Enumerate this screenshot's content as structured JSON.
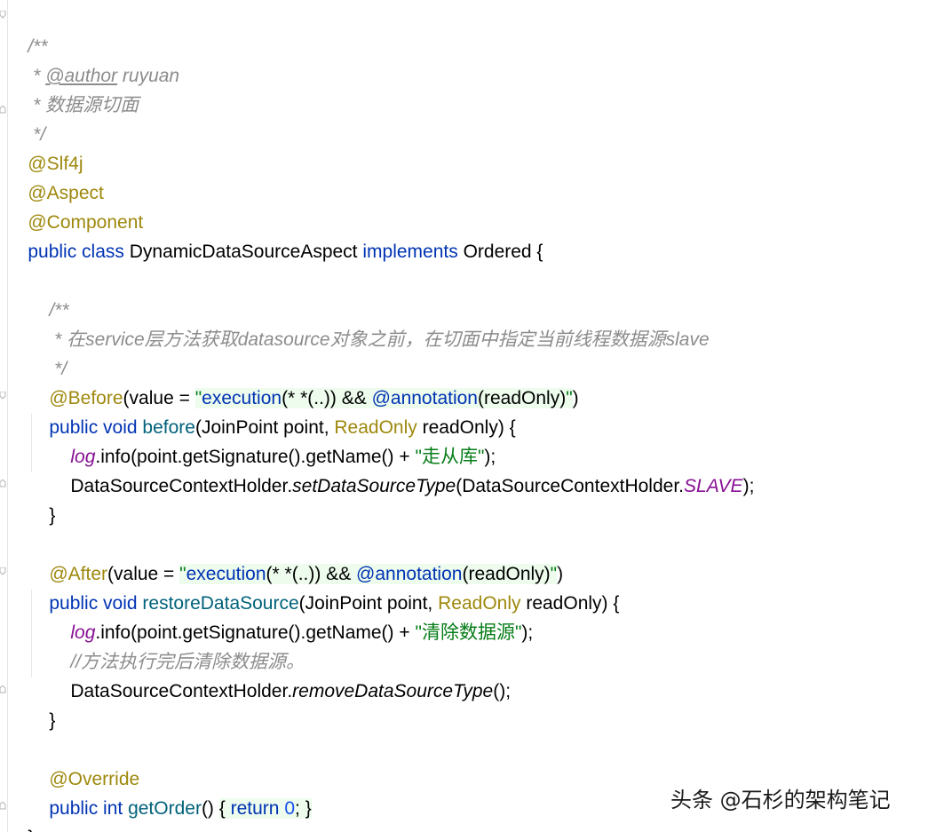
{
  "code": {
    "l1": "/**",
    "l2_prefix": " * ",
    "l2_tag": "@author",
    "l2_name": " ruyuan",
    "l3": " * 数据源切面",
    "l4": " */",
    "annot_slf4j": "@Slf4j",
    "annot_aspect": "@Aspect",
    "annot_component": "@Component",
    "class_kw": "public class ",
    "class_name": "DynamicDataSourceAspect ",
    "implements_kw": "implements ",
    "iface": "Ordered {",
    "doc1_open": "/**",
    "doc1_text": " * 在service层方法获取datasource对象之前，在切面中指定当前线程数据源slave",
    "doc1_close": " */",
    "before_annot": "@Before",
    "before_open": "(value = ",
    "before_q1": "\"",
    "before_exec": "execution",
    "before_mid": "(* *(..)) && ",
    "before_annot_in": "@annotation",
    "before_args": "(readOnly)",
    "before_q2": "\"",
    "before_close": ")",
    "m1_kw": "public void ",
    "m1_name": "before",
    "m1_p1": "(JoinPoint point, ",
    "m1_type": "ReadOnly",
    "m1_p2": " readOnly) {",
    "log1_field": "log",
    "log1_call": ".info(point.getSignature().getName() + ",
    "log1_str": "\"走从库\"",
    "log1_end": ");",
    "set_call_a": "DataSourceContextHolder.",
    "set_call_m": "setDataSourceType",
    "set_call_b": "(DataSourceContextHolder.",
    "set_call_f": "SLAVE",
    "set_call_c": ");",
    "brace_close": "}",
    "after_annot": "@After",
    "after_open": "(value = ",
    "after_q1": "\"",
    "after_exec": "execution",
    "after_mid": "(* *(..)) && ",
    "after_annot_in": "@annotation",
    "after_args": "(readOnly)",
    "after_q2": "\"",
    "after_close": ")",
    "m2_kw": "public void ",
    "m2_name": "restoreDataSource",
    "m2_p1": "(JoinPoint point, ",
    "m2_type": "ReadOnly",
    "m2_p2": " readOnly) {",
    "log2_field": "log",
    "log2_call": ".info(point.getSignature().getName() + ",
    "log2_str": "\"清除数据源\"",
    "log2_end": ");",
    "line_comment": "//方法执行完后清除数据源。",
    "remove_a": "DataSourceContextHolder.",
    "remove_m": "removeDataSourceType",
    "remove_b": "();",
    "override_annot": "@Override",
    "m3_kw": "public int ",
    "m3_name": "getOrder",
    "m3_parens": "() ",
    "m3_body_open": "{ ",
    "m3_return": "return ",
    "m3_zero": "0",
    "m3_semi": "; ",
    "m3_body_close": "}",
    "class_close": "}"
  },
  "watermark": "头条 @石杉的架构笔记",
  "colors": {
    "comment": "#8c8c8c",
    "annotation": "#9e880d",
    "keyword": "#0033b3",
    "string": "#067d17",
    "method": "#00627a",
    "field": "#871094",
    "number": "#1750eb"
  }
}
